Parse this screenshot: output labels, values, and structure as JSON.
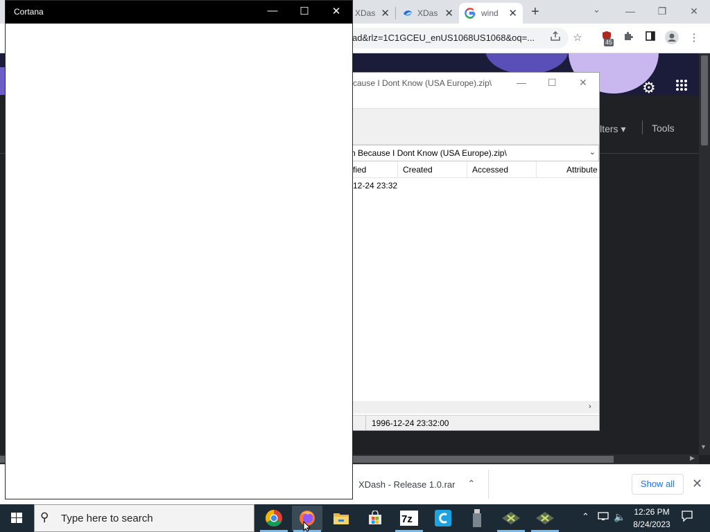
{
  "chrome": {
    "tabs": [
      {
        "label": "XDas",
        "close": "✕"
      },
      {
        "label": "XDas",
        "close": "✕"
      },
      {
        "label": "wind",
        "close": "✕"
      }
    ],
    "new_tab": "+",
    "tab_search": "⌄",
    "window_controls": {
      "minimize": "—",
      "restore": "❐",
      "close": "✕"
    },
    "address": "ad&rlz=1C1GCEU_enUS1068US1068&oq=...",
    "extension_badge": "45",
    "search_page": {
      "filters": "ilters ▾",
      "tools": "Tools"
    }
  },
  "download_bar": {
    "file_name": "XDash - Release 1.0.rar",
    "chevron": "⌃",
    "show_all": "Show all",
    "close": "✕"
  },
  "sevenzip": {
    "title": "cause I Dont Know (USA Europe).zip\\",
    "path": "n Because I Dont Know (USA Europe).zip\\",
    "columns": [
      "fied",
      "Created",
      "Accessed",
      "Attribute"
    ],
    "rows": [
      {
        "modified": "12-24 23:32"
      }
    ],
    "status_text": "1996-12-24 23:32:00"
  },
  "cortana": {
    "title": "Cortana",
    "controls": {
      "minimize": "—",
      "maximize": "☐",
      "close": "✕"
    }
  },
  "taskbar": {
    "search_placeholder": "Type here to search",
    "apps": [
      "chrome-icon",
      "firefox-icon",
      "file-explorer-icon",
      "microsoft-store-icon",
      "7zip-icon",
      "ccleaner-icon",
      "usb-drive-icon",
      "xbox-app-icon",
      "xbox-app-icon"
    ],
    "clock_time": "12:26 PM",
    "clock_date": "8/24/2023"
  },
  "colors": {
    "taskbar": "#1c2a35",
    "chrome_dark": "#202124",
    "accent_blue": "#1a73e8",
    "cortana_title": "#000000"
  }
}
